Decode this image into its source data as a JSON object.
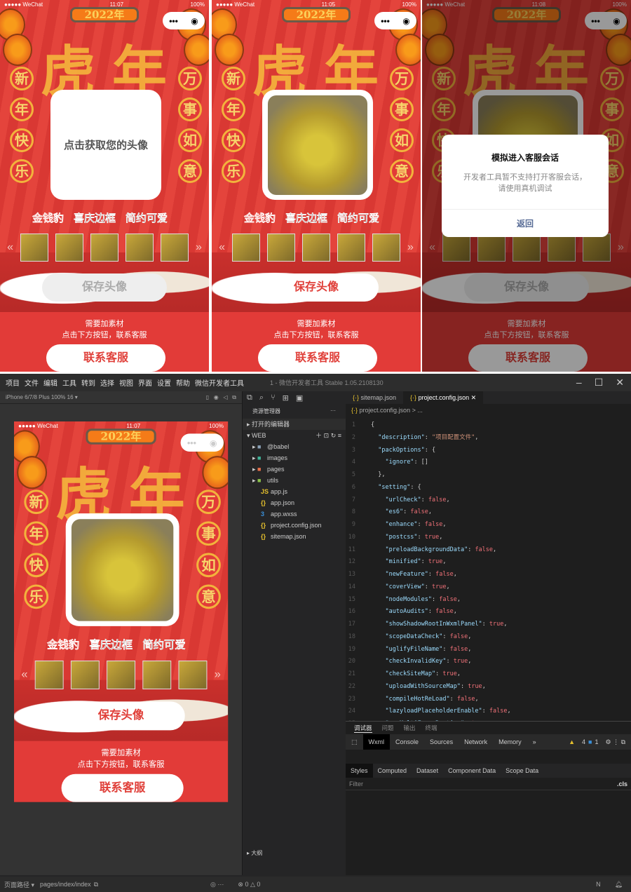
{
  "phones": [
    {
      "carrier": "●●●●● WeChat",
      "time": "11:07",
      "battery": "100%",
      "year": "2022年",
      "avatar_prompt": "点击获取您的头像",
      "save_disabled": true,
      "modal": false
    },
    {
      "carrier": "●●●●● WeChat",
      "time": "11:05",
      "battery": "100%",
      "year": "2022年",
      "avatar_prompt": "",
      "save_disabled": false,
      "modal": false
    },
    {
      "carrier": "●●●●● WeChat",
      "time": "11:08",
      "battery": "100%",
      "year": "2022年",
      "avatar_prompt": "",
      "save_disabled": true,
      "modal": true
    },
    {
      "carrier": "●●●●● WeChat",
      "time": "11:07",
      "battery": "100%",
      "year": "2022年",
      "avatar_prompt": "",
      "save_disabled": false,
      "modal": false
    }
  ],
  "page": {
    "big_chars": [
      "虎",
      "年"
    ],
    "couplet_left": [
      "新",
      "年",
      "快",
      "乐"
    ],
    "couplet_right": [
      "万",
      "事",
      "如",
      "意"
    ],
    "categories": [
      "金钱豹",
      "喜庆边框",
      "简约可爱"
    ],
    "save_label": "保存头像",
    "tip_line1": "需要加素材",
    "tip_line2": "点击下方按钮，联系客服",
    "contact_label": "联系客服",
    "modal_title": "模拟进入客服会话",
    "modal_text1": "开发者工具暂不支持打开客服会话，",
    "modal_text2": "请使用真机调试",
    "modal_return": "返回"
  },
  "ide": {
    "menu": [
      "项目",
      "文件",
      "编辑",
      "工具",
      "转到",
      "选择",
      "视图",
      "界面",
      "设置",
      "帮助",
      "微信开发者工具"
    ],
    "window_title": "1 - 微信开发者工具 Stable 1.05.2108130",
    "device": "iPhone 6/7/8 Plus 100% 16 ▾",
    "explorer_title": "资源管理器",
    "open_editors": "打开的编辑器",
    "root": "WEB",
    "tree": [
      {
        "name": "@babel",
        "folder": true,
        "color": "#8aa0b5"
      },
      {
        "name": "images",
        "folder": true,
        "color": "#3fb59a"
      },
      {
        "name": "pages",
        "folder": true,
        "color": "#e8704a"
      },
      {
        "name": "utils",
        "folder": true,
        "color": "#8bc34a"
      },
      {
        "name": "app.js",
        "folder": false,
        "icon": "JS",
        "color": "#e5c02d"
      },
      {
        "name": "app.json",
        "folder": false,
        "icon": "{}",
        "color": "#e5c02d"
      },
      {
        "name": "app.wxss",
        "folder": false,
        "icon": "3",
        "color": "#3a8fd8"
      },
      {
        "name": "project.config.json",
        "folder": false,
        "icon": "{}",
        "color": "#e5c02d"
      },
      {
        "name": "sitemap.json",
        "folder": false,
        "icon": "{}",
        "color": "#e5c02d"
      }
    ],
    "outline": "大纲",
    "tabs": [
      "sitemap.json",
      "project.config.json"
    ],
    "breadcrumb": "project.config.json > ...",
    "code": [
      "{",
      "  \"description\": \"项目配置文件\",",
      "  \"packOptions\": {",
      "    \"ignore\": []",
      "  },",
      "  \"setting\": {",
      "    \"urlCheck\": false,",
      "    \"es6\": false,",
      "    \"enhance\": false,",
      "    \"postcss\": true,",
      "    \"preloadBackgroundData\": false,",
      "    \"minified\": true,",
      "    \"newFeature\": false,",
      "    \"coverView\": true,",
      "    \"nodeModules\": false,",
      "    \"autoAudits\": false,",
      "    \"showShadowRootInWxmlPanel\": true,",
      "    \"scopeDataCheck\": false,",
      "    \"uglifyFileName\": false,",
      "    \"checkInvalidKey\": true,",
      "    \"checkSiteMap\": true,",
      "    \"uploadWithSourceMap\": true,",
      "    \"compileHotReLoad\": false,",
      "    \"lazyloadPlaceholderEnable\": false,",
      "    \"useMultiFrameRuntime\": true,"
    ],
    "dev_tabs": [
      "调试器",
      "问题",
      "输出",
      "终端"
    ],
    "dev_tools": [
      "Wxml",
      "Console",
      "Sources",
      "Network",
      "Memory",
      "»"
    ],
    "warnings": "4",
    "infos": "1",
    "style_tabs": [
      "Styles",
      "Computed",
      "Dataset",
      "Component Data",
      "Scope Data"
    ],
    "filter_placeholder": "Filter",
    "cls": ".cls",
    "page_path_label": "页面路径 ▾",
    "page_path": "pages/index/index",
    "errors": "0",
    "warn_count": "0",
    "status_n": "N"
  }
}
